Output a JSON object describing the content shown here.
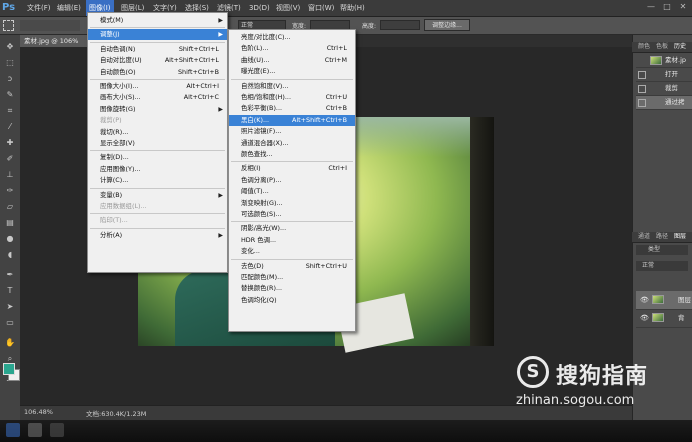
{
  "app": {
    "logo": "Ps"
  },
  "menubar": [
    {
      "label": "文件(F)"
    },
    {
      "label": "编辑(E)"
    },
    {
      "label": "图像(I)"
    },
    {
      "label": "图层(L)"
    },
    {
      "label": "文字(Y)"
    },
    {
      "label": "选择(S)"
    },
    {
      "label": "滤镜(T)"
    },
    {
      "label": "3D(D)"
    },
    {
      "label": "视图(V)"
    },
    {
      "label": "窗口(W)"
    },
    {
      "label": "帮助(H)"
    }
  ],
  "window_controls": {
    "minimize": "—",
    "maximize": "□",
    "close": "✕"
  },
  "options": {
    "style_value": "正常",
    "width_label": "宽度:",
    "height_label": "高度:",
    "refine_button": "调整边缘..."
  },
  "document": {
    "tab": "素材.jpg @ 106%"
  },
  "status": {
    "zoom": "106.48%",
    "doc": "文档:630.4K/1.23M"
  },
  "image_menu": [
    {
      "label": "模式(M)",
      "submenu": true
    },
    {
      "sep": true
    },
    {
      "label": "调整(J)",
      "submenu": true,
      "highlight": true
    },
    {
      "sep": true
    },
    {
      "label": "自动色调(N)",
      "shortcut": "Shift+Ctrl+L"
    },
    {
      "label": "自动对比度(U)",
      "shortcut": "Alt+Shift+Ctrl+L"
    },
    {
      "label": "自动颜色(O)",
      "shortcut": "Shift+Ctrl+B"
    },
    {
      "sep": true
    },
    {
      "label": "图像大小(I)...",
      "shortcut": "Alt+Ctrl+I"
    },
    {
      "label": "画布大小(S)...",
      "shortcut": "Alt+Ctrl+C"
    },
    {
      "label": "图像旋转(G)",
      "submenu": true
    },
    {
      "label": "裁剪(P)",
      "disabled": true
    },
    {
      "label": "裁切(R)..."
    },
    {
      "label": "显示全部(V)"
    },
    {
      "sep": true
    },
    {
      "label": "复制(D)..."
    },
    {
      "label": "应用图像(Y)..."
    },
    {
      "label": "计算(C)..."
    },
    {
      "sep": true
    },
    {
      "label": "变量(B)",
      "submenu": true
    },
    {
      "label": "应用数据组(L)...",
      "disabled": true
    },
    {
      "sep": true
    },
    {
      "label": "陷印(T)...",
      "disabled": true
    },
    {
      "sep": true
    },
    {
      "label": "分析(A)",
      "submenu": true
    }
  ],
  "adjust_menu": [
    {
      "label": "亮度/对比度(C)..."
    },
    {
      "label": "色阶(L)...",
      "shortcut": "Ctrl+L"
    },
    {
      "label": "曲线(U)...",
      "shortcut": "Ctrl+M"
    },
    {
      "label": "曝光度(E)..."
    },
    {
      "sep": true
    },
    {
      "label": "自然饱和度(V)..."
    },
    {
      "label": "色相/饱和度(H)...",
      "shortcut": "Ctrl+U"
    },
    {
      "label": "色彩平衡(B)...",
      "shortcut": "Ctrl+B"
    },
    {
      "label": "黑白(K)...",
      "shortcut": "Alt+Shift+Ctrl+B",
      "highlight": true
    },
    {
      "label": "照片滤镜(F)..."
    },
    {
      "label": "通道混合器(X)..."
    },
    {
      "label": "颜色查找..."
    },
    {
      "sep": true
    },
    {
      "label": "反相(I)",
      "shortcut": "Ctrl+I"
    },
    {
      "label": "色调分离(P)..."
    },
    {
      "label": "阈值(T)..."
    },
    {
      "label": "渐变映射(G)..."
    },
    {
      "label": "可选颜色(S)..."
    },
    {
      "sep": true
    },
    {
      "label": "阴影/高光(W)..."
    },
    {
      "label": "HDR 色调..."
    },
    {
      "label": "变化..."
    },
    {
      "sep": true
    },
    {
      "label": "去色(D)",
      "shortcut": "Shift+Ctrl+U"
    },
    {
      "label": "匹配颜色(M)..."
    },
    {
      "label": "替换颜色(R)..."
    },
    {
      "label": "色调均化(Q)"
    }
  ],
  "panels": {
    "top_tabs": [
      "颜色",
      "色板",
      "历史"
    ],
    "history": [
      {
        "label": "素材.jp"
      },
      {
        "label": "打开"
      },
      {
        "label": "裁剪"
      },
      {
        "label": "通过拷"
      }
    ],
    "layer_tabs": [
      "通道",
      "路径",
      "图层"
    ],
    "layer_kind": "类型",
    "blend_mode": "正常",
    "layers": [
      {
        "label": "图层"
      },
      {
        "label": "背"
      }
    ]
  },
  "watermark": {
    "glyph": "S",
    "text": "搜狗指南",
    "url": "zhinan.sogou.com"
  },
  "colors": {
    "accent": "#3a82d6",
    "foreground": "#2aa68f",
    "background": "#f0f0f0"
  }
}
